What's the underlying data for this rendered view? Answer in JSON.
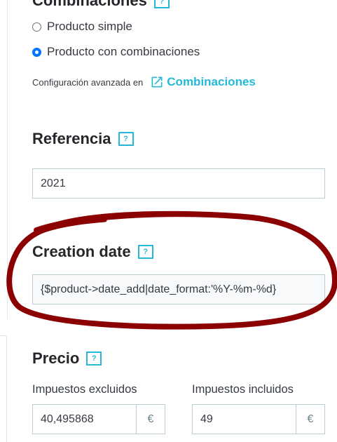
{
  "combinations": {
    "title": "Combinaciones",
    "help": "?",
    "options": [
      {
        "label": "Producto simple",
        "checked": false
      },
      {
        "label": "Producto con combinaciones",
        "checked": true
      }
    ],
    "config_text": "Configuración avanzada en",
    "config_link_icon": "external-link-icon",
    "config_link": "Combinaciones"
  },
  "reference": {
    "title": "Referencia",
    "help": "?",
    "value": "2021"
  },
  "creation_date": {
    "title": "Creation date",
    "help": "?",
    "value": "{$product->date_add|date_format:'%Y-%m-%d}"
  },
  "price": {
    "title": "Precio",
    "help": "?",
    "excl_label": "Impuestos excluidos",
    "excl_value": "40,495868",
    "incl_label": "Impuestos incluidos",
    "incl_value": "49",
    "currency": "€"
  },
  "colors": {
    "accent": "#25b9d7",
    "annotation": "#8b0000"
  }
}
